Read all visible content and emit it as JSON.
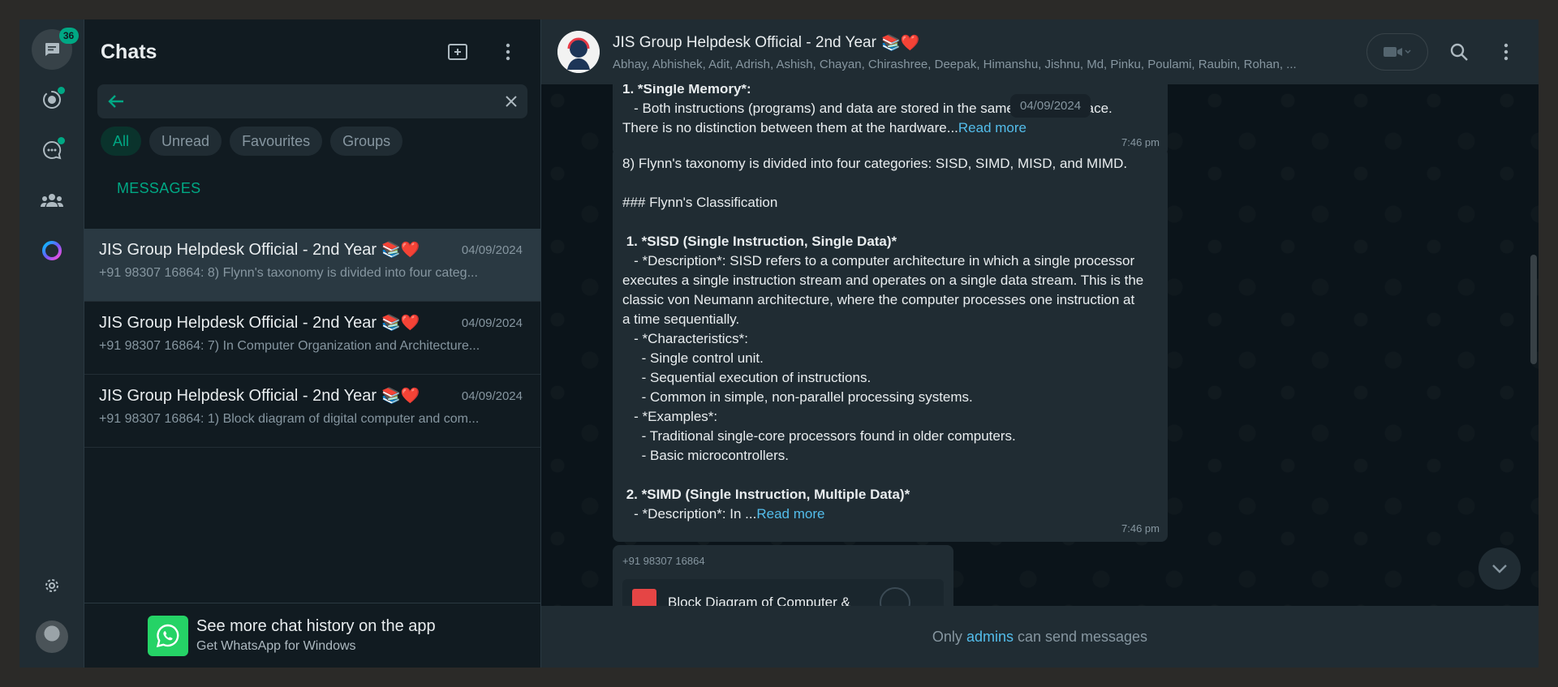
{
  "rail": {
    "unread_count": "36"
  },
  "side": {
    "title": "Chats",
    "search": {
      "value": "",
      "placeholder": ""
    },
    "filters": [
      "All",
      "Unread",
      "Favourites",
      "Groups"
    ],
    "section_label": "MESSAGES",
    "chats": [
      {
        "name": "JIS Group Helpdesk Official - 2nd Year",
        "emoji": "📚❤️",
        "date": "04/09/2024",
        "preview": "+91 98307 16864: 8) Flynn's taxonomy is divided into four categ..."
      },
      {
        "name": "JIS Group Helpdesk Official - 2nd Year",
        "emoji": "📚❤️",
        "date": "04/09/2024",
        "preview": "+91 98307 16864: 7) In Computer Organization and Architecture..."
      },
      {
        "name": "JIS Group Helpdesk Official - 2nd Year",
        "emoji": "📚❤️",
        "date": "04/09/2024",
        "preview": "+91 98307 16864: 1) Block diagram of digital computer and com..."
      }
    ],
    "footer": {
      "title": "See more chat history on the app",
      "subtitle": "Get WhatsApp for Windows"
    }
  },
  "conversation": {
    "title": "JIS Group Helpdesk Official - 2nd Year",
    "title_emoji": "📚❤️",
    "members": "Abhay, Abhishek, Adit, Adrish, Ashish, Chayan, Chirashree, Deepak, Himanshu, Jishnu, Md, Pinku, Poulami, Raubin, Rohan, ...",
    "date_pill": "04/09/2024",
    "msg1": {
      "line1": "1. *Single Memory*:",
      "line2": "   - Both instructions (programs) and data are stored in the same memory space.",
      "line3": "There is no distinction between them at the hardware...",
      "read_more": "Read more",
      "time": "7:46 pm"
    },
    "msg2": {
      "lines": [
        "8) Flynn's taxonomy is divided into four categories: SISD, SIMD, MISD, and MIMD.",
        "",
        "### Flynn's Classification",
        "",
        " 1. *SISD (Single Instruction, Single Data)*",
        "   - *Description*: SISD refers to a computer architecture in which a single processor",
        "executes a single instruction stream and operates on a single data stream. This is the",
        "classic von Neumann architecture, where the computer processes one instruction at",
        "a time sequentially.",
        "   - *Characteristics*:",
        "     - Single control unit.",
        "     - Sequential execution of instructions.",
        "     - Common in simple, non-parallel processing systems.",
        "   - *Examples*:",
        "     - Traditional single-core processors found in older computers.",
        "     - Basic microcontrollers.",
        "",
        " 2. *SIMD (Single Instruction, Multiple Data)*"
      ],
      "last_line": "   - *Description*: In ...",
      "read_more": "Read more",
      "time": "7:46 pm"
    },
    "msg3": {
      "sender": "+91 98307 16864",
      "doc_name": "Block Diagram of Computer &"
    },
    "footer": {
      "before": "Only",
      "link": "admins",
      "after": "can send messages"
    }
  }
}
